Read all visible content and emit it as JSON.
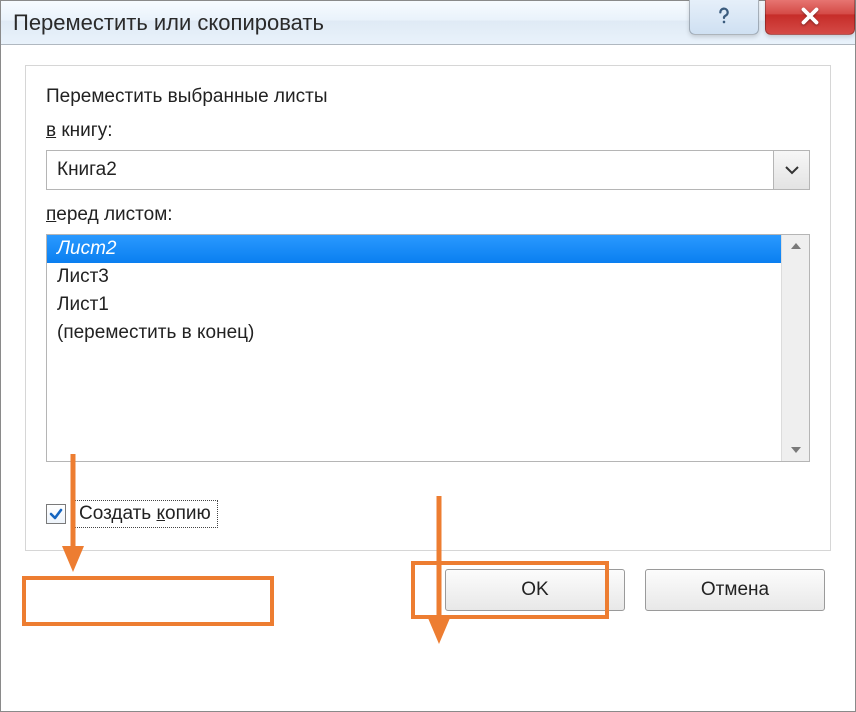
{
  "title": "Переместить или скопировать",
  "body": {
    "instruction": "Переместить выбранные листы",
    "book_label_pre": "в",
    "book_label_post": " книгу:",
    "book_value": "Книга2",
    "sheet_label_pre": "п",
    "sheet_label_post": "еред листом:",
    "sheets": [
      {
        "label": "Лист2",
        "selected": true
      },
      {
        "label": "Лист3",
        "selected": false
      },
      {
        "label": "Лист1",
        "selected": false
      },
      {
        "label": "(переместить в конец)",
        "selected": false
      }
    ],
    "copy_checkbox_pre": "Создать ",
    "copy_checkbox_accel": "к",
    "copy_checkbox_post": "опию",
    "copy_checked": true,
    "ok": "OK",
    "cancel": "Отмена"
  }
}
